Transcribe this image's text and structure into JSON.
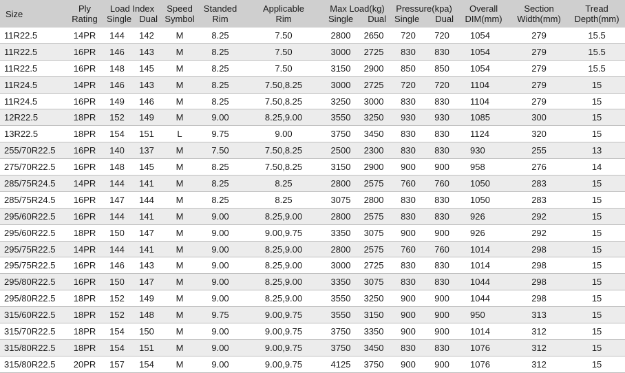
{
  "headers": {
    "size": "Size",
    "ply_1": "Ply",
    "ply_2": "Rating",
    "load_1": "Load Index",
    "load_single": "Single",
    "load_dual": "Dual",
    "speed_1": "Speed",
    "speed_2": "Symbol",
    "std_1": "Standed",
    "std_2": "Rim",
    "app_1": "Applicable",
    "app_2": "Rim",
    "maxload_1": "Max Load(kg)",
    "maxload_single": "Single",
    "maxload_dual": "Dual",
    "pressure_1": "Pressure(kpa)",
    "pressure_single": "Single",
    "pressure_dual": "Dual",
    "overall_1": "Overall",
    "overall_2": "DIM(mm)",
    "section_1": "Section",
    "section_2": "Width(mm)",
    "tread_1": "Tread",
    "tread_2": "Depth(mm)"
  },
  "rows": [
    [
      "11R22.5",
      "14PR",
      "144",
      "142",
      "M",
      "8.25",
      "7.50",
      "2800",
      "2650",
      "720",
      "720",
      "1054",
      "279",
      "15.5"
    ],
    [
      "11R22.5",
      "16PR",
      "146",
      "143",
      "M",
      "8.25",
      "7.50",
      "3000",
      "2725",
      "830",
      "830",
      "1054",
      "279",
      "15.5"
    ],
    [
      "11R22.5",
      "16PR",
      "148",
      "145",
      "M",
      "8.25",
      "7.50",
      "3150",
      "2900",
      "850",
      "850",
      "1054",
      "279",
      "15.5"
    ],
    [
      "11R24.5",
      "14PR",
      "146",
      "143",
      "M",
      "8.25",
      "7.50,8.25",
      "3000",
      "2725",
      "720",
      "720",
      "1104",
      "279",
      "15"
    ],
    [
      "11R24.5",
      "16PR",
      "149",
      "146",
      "M",
      "8.25",
      "7.50,8.25",
      "3250",
      "3000",
      "830",
      "830",
      "1104",
      "279",
      "15"
    ],
    [
      "12R22.5",
      "18PR",
      "152",
      "149",
      "M",
      "9.00",
      "8.25,9.00",
      "3550",
      "3250",
      "930",
      "930",
      "1085",
      "300",
      "15"
    ],
    [
      "13R22.5",
      "18PR",
      "154",
      "151",
      "L",
      "9.75",
      "9.00",
      "3750",
      "3450",
      "830",
      "830",
      "1124",
      "320",
      "15"
    ],
    [
      "255/70R22.5",
      "16PR",
      "140",
      "137",
      "M",
      "7.50",
      "7.50,8.25",
      "2500",
      "2300",
      "830",
      "830",
      "930",
      "255",
      "13"
    ],
    [
      "275/70R22.5",
      "16PR",
      "148",
      "145",
      "M",
      "8.25",
      "7.50,8.25",
      "3150",
      "2900",
      "900",
      "900",
      "958",
      "276",
      "14"
    ],
    [
      "285/75R24.5",
      "14PR",
      "144",
      "141",
      "M",
      "8.25",
      "8.25",
      "2800",
      "2575",
      "760",
      "760",
      "1050",
      "283",
      "15"
    ],
    [
      "285/75R24.5",
      "16PR",
      "147",
      "144",
      "M",
      "8.25",
      "8.25",
      "3075",
      "2800",
      "830",
      "830",
      "1050",
      "283",
      "15"
    ],
    [
      "295/60R22.5",
      "16PR",
      "144",
      "141",
      "M",
      "9.00",
      "8.25,9.00",
      "2800",
      "2575",
      "830",
      "830",
      "926",
      "292",
      "15"
    ],
    [
      "295/60R22.5",
      "18PR",
      "150",
      "147",
      "M",
      "9.00",
      "9.00,9.75",
      "3350",
      "3075",
      "900",
      "900",
      "926",
      "292",
      "15"
    ],
    [
      "295/75R22.5",
      "14PR",
      "144",
      "141",
      "M",
      "9.00",
      "8.25,9.00",
      "2800",
      "2575",
      "760",
      "760",
      "1014",
      "298",
      "15"
    ],
    [
      "295/75R22.5",
      "16PR",
      "146",
      "143",
      "M",
      "9.00",
      "8.25,9.00",
      "3000",
      "2725",
      "830",
      "830",
      "1014",
      "298",
      "15"
    ],
    [
      "295/80R22.5",
      "16PR",
      "150",
      "147",
      "M",
      "9.00",
      "8.25,9.00",
      "3350",
      "3075",
      "830",
      "830",
      "1044",
      "298",
      "15"
    ],
    [
      "295/80R22.5",
      "18PR",
      "152",
      "149",
      "M",
      "9.00",
      "8.25,9.00",
      "3550",
      "3250",
      "900",
      "900",
      "1044",
      "298",
      "15"
    ],
    [
      "315/60R22.5",
      "18PR",
      "152",
      "148",
      "M",
      "9.75",
      "9.00,9.75",
      "3550",
      "3150",
      "900",
      "900",
      "950",
      "313",
      "15"
    ],
    [
      "315/70R22.5",
      "18PR",
      "154",
      "150",
      "M",
      "9.00",
      "9.00,9.75",
      "3750",
      "3350",
      "900",
      "900",
      "1014",
      "312",
      "15"
    ],
    [
      "315/80R22.5",
      "18PR",
      "154",
      "151",
      "M",
      "9.00",
      "9.00,9.75",
      "3750",
      "3450",
      "830",
      "830",
      "1076",
      "312",
      "15"
    ],
    [
      "315/80R22.5",
      "20PR",
      "157",
      "154",
      "M",
      "9.00",
      "9.00,9.75",
      "4125",
      "3750",
      "900",
      "900",
      "1076",
      "312",
      "15"
    ]
  ]
}
